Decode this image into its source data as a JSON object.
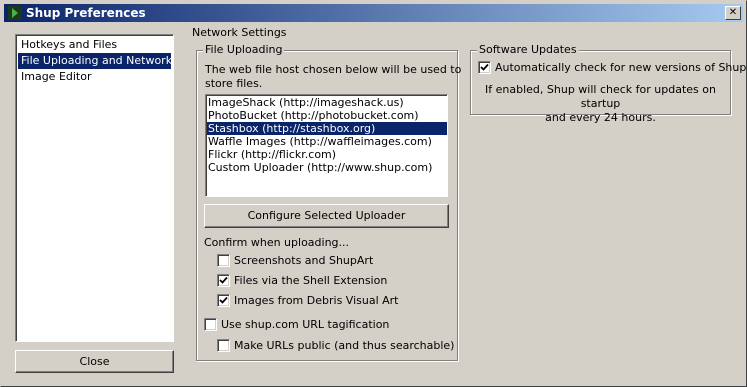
{
  "window": {
    "title": "Shup Preferences",
    "close_glyph": "✕"
  },
  "sidebar": {
    "items": [
      {
        "label": "Hotkeys and Files",
        "selected": false
      },
      {
        "label": "File Uploading and Network",
        "selected": true
      },
      {
        "label": "Image Editor",
        "selected": false
      }
    ]
  },
  "close_button": {
    "label": "Close"
  },
  "network": {
    "group_label": "Network Settings",
    "uploading": {
      "group_label": "File Uploading",
      "description_line1": "The web file host chosen below will be used to",
      "description_line2": "store files.",
      "hosts": [
        {
          "label": "ImageShack (http://imageshack.us)",
          "selected": false
        },
        {
          "label": "PhotoBucket (http://photobucket.com)",
          "selected": false
        },
        {
          "label": "Stashbox (http://stashbox.org)",
          "selected": true
        },
        {
          "label": "Waffle Images (http://waffleimages.com)",
          "selected": false
        },
        {
          "label": "Flickr (http://flickr.com)",
          "selected": false
        },
        {
          "label": "Custom Uploader (http://www.shup.com)",
          "selected": false
        }
      ],
      "configure_label": "Configure Selected Uploader",
      "confirm_label": "Confirm when uploading...",
      "confirm_options": [
        {
          "label": "Screenshots and ShupArt",
          "checked": false
        },
        {
          "label": "Files via the Shell Extension",
          "checked": true
        },
        {
          "label": "Images from Debris Visual Art",
          "checked": true
        }
      ],
      "tagification": {
        "label": "Use shup.com URL tagification",
        "checked": false
      },
      "public_urls": {
        "label": "Make URLs public (and thus searchable)",
        "checked": false
      }
    },
    "updates": {
      "group_label": "Software Updates",
      "auto_check": {
        "label": "Automatically check for new versions of Shup?",
        "checked": true
      },
      "note_line1": "If enabled, Shup will check for updates on startup",
      "note_line2": "and every 24 hours."
    }
  },
  "colors": {
    "selection": "#0a246a",
    "face": "#d4d0c8",
    "title_gradient_end": "#a6caf0"
  }
}
